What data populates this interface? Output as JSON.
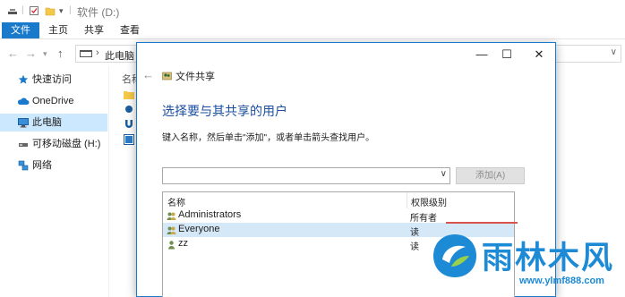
{
  "explorer": {
    "title": "软件 (D:)",
    "tabs": [
      {
        "label": "文件"
      },
      {
        "label": "主页"
      },
      {
        "label": "共享"
      },
      {
        "label": "查看"
      }
    ],
    "address": {
      "crumb": "此电脑"
    },
    "column_name": "名称",
    "sidebar": [
      {
        "label": "快速访问",
        "icon": "star-icon"
      },
      {
        "label": "OneDrive",
        "icon": "cloud-icon"
      },
      {
        "label": "此电脑",
        "icon": "computer-icon",
        "selected": true
      },
      {
        "label": "可移动磁盘 (H:)",
        "icon": "usb-drive-icon"
      },
      {
        "label": "网络",
        "icon": "network-icon"
      }
    ]
  },
  "dialog": {
    "window_title": "文件共享",
    "heading": "选择要与其共享的用户",
    "instruction": "键入名称，然后单击\"添加\"，或者单击箭头查找用户。",
    "add_button": "添加(A)",
    "combo_value": "",
    "list": {
      "col_name": "名称",
      "col_permission": "权限级别",
      "rows": [
        {
          "name": "Administrators",
          "permission": "所有者",
          "selected": false
        },
        {
          "name": "Everyone",
          "permission": "读",
          "selected": true
        },
        {
          "name": "zz",
          "permission": "读",
          "selected": false
        }
      ]
    }
  },
  "watermark": {
    "text": "雨林木风",
    "url": "www.ylmf888.com"
  },
  "colors": {
    "accent": "#1979ca",
    "heading": "#1c4ea0",
    "selection": "#cce8ff",
    "watermark": "#1d8ad6"
  }
}
